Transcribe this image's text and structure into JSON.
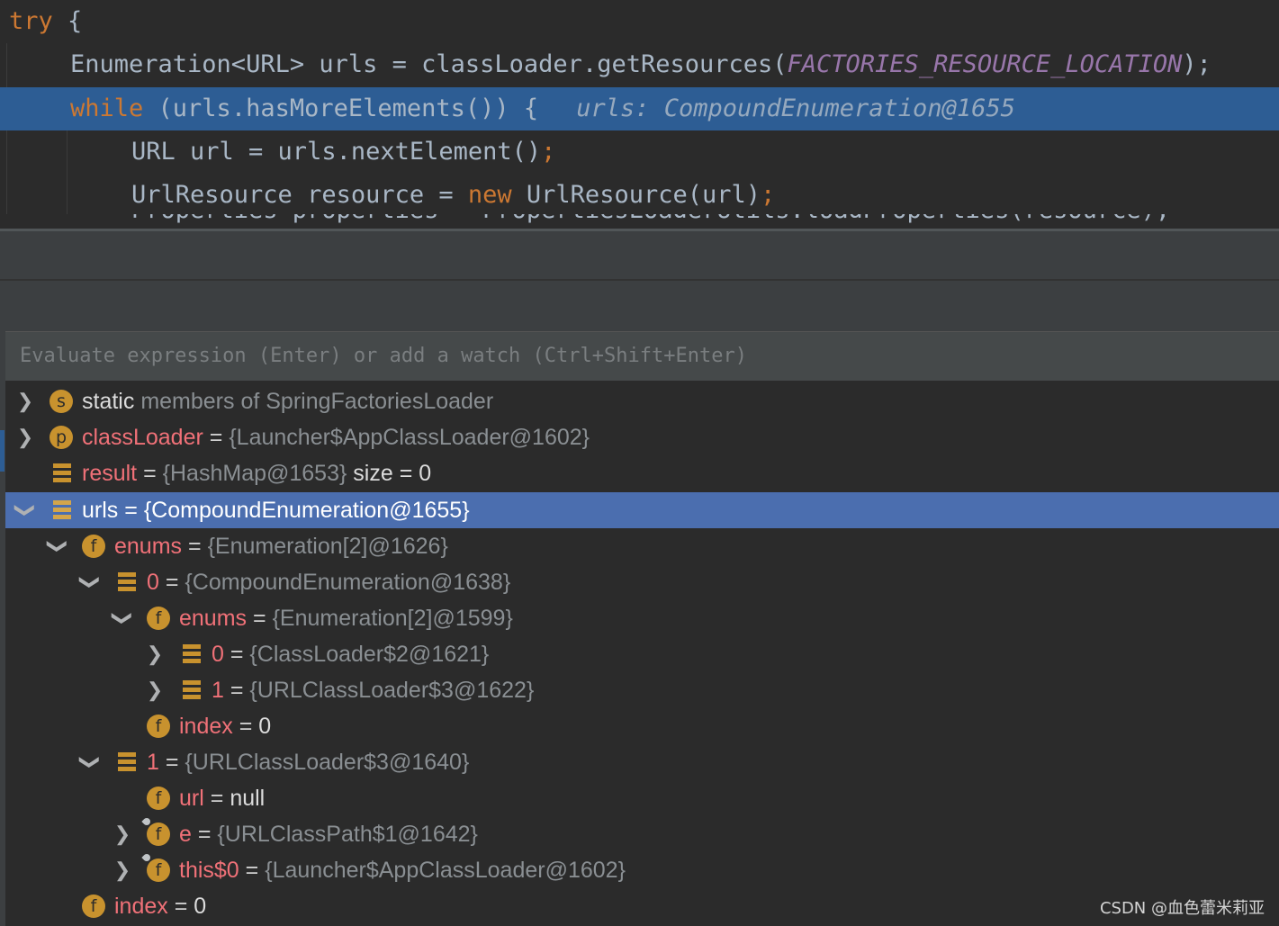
{
  "editor": {
    "line1": {
      "kw": "try",
      "rest": " {"
    },
    "line2": {
      "pre": "Enumeration<URL> urls = classLoader.getResources(",
      "const": "FACTORIES_RESOURCE_LOCATION",
      "post": ");"
    },
    "line3": {
      "kw": "while",
      "rest": " (urls.hasMoreElements()) {",
      "hint": "urls: CompoundEnumeration@1655"
    },
    "line4": {
      "text": "URL url = urls.nextElement()",
      "semi": ";"
    },
    "line5": {
      "pre": "UrlResource resource = ",
      "kw": "new",
      "post": " UrlResource(url)",
      "semi": ";"
    },
    "line6_partial": "Properties properties = PropertiesLoaderUtils.loadProperties(resource);"
  },
  "watch": {
    "placeholder": "Evaluate expression (Enter) or add a watch (Ctrl+Shift+Enter)"
  },
  "tree": {
    "static": {
      "icon": "s",
      "name": "static",
      "rest": "members of SpringFactoriesLoader"
    },
    "classLoader": {
      "icon": "p",
      "name": "classLoader",
      "eq": "=",
      "val": "{Launcher$AppClassLoader@1602}"
    },
    "result": {
      "name": "result",
      "eq": "=",
      "val": "{HashMap@1653}",
      "extra": "size = 0"
    },
    "urls": {
      "name": "urls",
      "eq": "=",
      "val": "{CompoundEnumeration@1655}"
    },
    "enums": {
      "icon": "f",
      "name": "enums",
      "eq": "=",
      "val": "{Enumeration[2]@1626}"
    },
    "enums_0": {
      "name": "0",
      "eq": "=",
      "val": "{CompoundEnumeration@1638}"
    },
    "enums_0_enums": {
      "icon": "f",
      "name": "enums",
      "eq": "=",
      "val": "{Enumeration[2]@1599}"
    },
    "enums_0_enums_0": {
      "name": "0",
      "eq": "=",
      "val": "{ClassLoader$2@1621}"
    },
    "enums_0_enums_1": {
      "name": "1",
      "eq": "=",
      "val": "{URLClassLoader$3@1622}"
    },
    "enums_0_index": {
      "icon": "f",
      "name": "index",
      "eq": "=",
      "val": "0"
    },
    "enums_1": {
      "name": "1",
      "eq": "=",
      "val": "{URLClassLoader$3@1640}"
    },
    "enums_1_url": {
      "icon": "f",
      "name": "url",
      "eq": "=",
      "val": "null"
    },
    "enums_1_e": {
      "icon": "f",
      "name": "e",
      "eq": "=",
      "val": "{URLClassPath$1@1642}"
    },
    "enums_1_this0": {
      "icon": "f",
      "name": "this$0",
      "eq": "=",
      "val": "{Launcher$AppClassLoader@1602}"
    },
    "index": {
      "icon": "f",
      "name": "index",
      "eq": "=",
      "val": "0"
    }
  },
  "watermark": "CSDN @血色蕾米莉亚",
  "colors": {
    "keyword": "#cc7832",
    "constant": "#9876aa",
    "selection": "#4b6eaf",
    "current_line": "#2d5d94",
    "field_icon": "#c8922e"
  }
}
